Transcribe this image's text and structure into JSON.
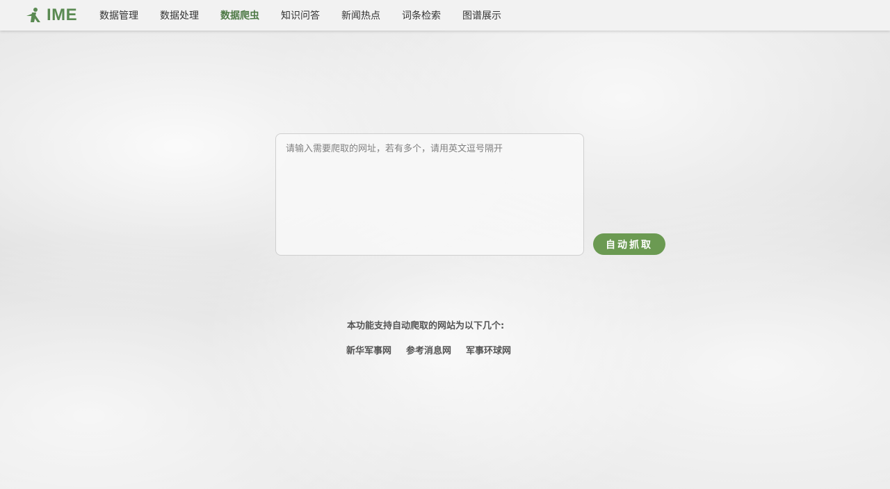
{
  "header": {
    "logo_text": "IME",
    "logo_icon": "ime-logo-icon",
    "nav": [
      {
        "label": "数据管理"
      },
      {
        "label": "数据处理"
      },
      {
        "label": "数据爬虫"
      },
      {
        "label": "知识问答"
      },
      {
        "label": "新闻热点"
      },
      {
        "label": "词条检索"
      },
      {
        "label": "图谱展示"
      }
    ],
    "active_nav": "数据爬虫"
  },
  "main": {
    "url_input": {
      "placeholder": "请输入需要爬取的网址，若有多个，请用英文逗号隔开",
      "value": ""
    },
    "fetch_button_label": "自动抓取",
    "info_title": "本功能支持自动爬取的网站为以下几个:",
    "sites": [
      {
        "label": "新华军事网"
      },
      {
        "label": "参考消息网"
      },
      {
        "label": "军事环球网"
      }
    ]
  },
  "colors": {
    "accent": "#5a8a52",
    "button": "#6b9a52",
    "header_bg": "#f2f2f2",
    "text": "#333333"
  }
}
